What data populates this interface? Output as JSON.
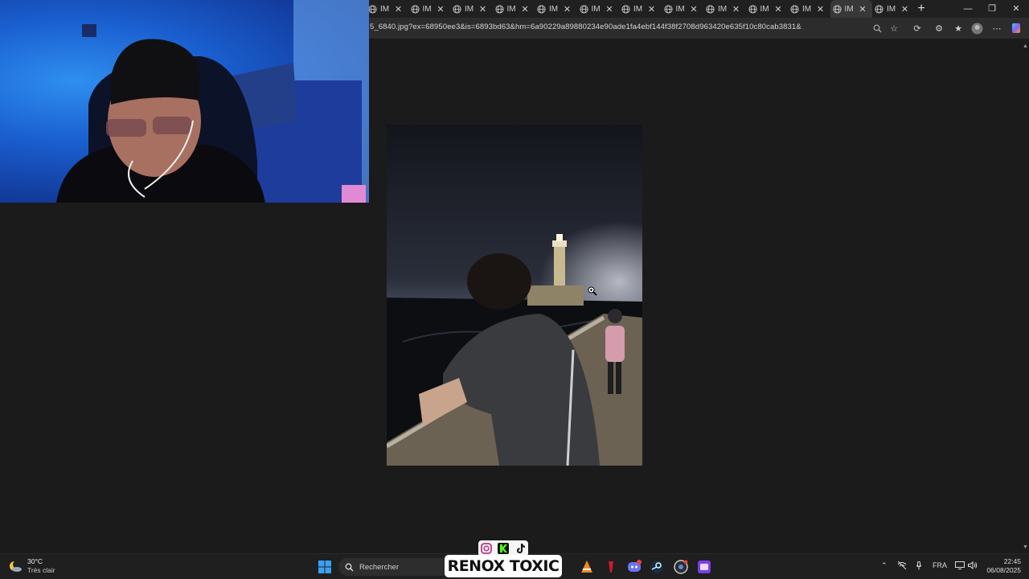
{
  "browser": {
    "tab_label": "IM",
    "tab_count": 13,
    "active_tab_index": 11,
    "address": "5_6840.jpg?ex=68950ee3&is=6893bd63&hm=6a90229a89880234e90ade1fa4ebf144f38f2708d963420e635f10c80cab3831&"
  },
  "tabs": [
    {
      "label": "IM"
    },
    {
      "label": "IM"
    },
    {
      "label": "IM"
    },
    {
      "label": "IM"
    },
    {
      "label": "IM"
    },
    {
      "label": "IM"
    },
    {
      "label": "IM"
    },
    {
      "label": "IM"
    },
    {
      "label": "IM"
    },
    {
      "label": "IM"
    },
    {
      "label": "IM"
    },
    {
      "label": "IM"
    },
    {
      "label": "IM"
    }
  ],
  "taskbar": {
    "weather_temp": "30°C",
    "weather_condition": "Très clair",
    "search_placeholder": "Rechercher",
    "language": "FRA",
    "time": "22:45",
    "date": "06/08/2025"
  },
  "overlay": {
    "brand_text": "RENOX TOXIC"
  },
  "colors": {
    "taskbar_bg": "#1f1f1f",
    "browser_bg": "#1b1b1b",
    "webcam_light": "#2f8ff0"
  }
}
